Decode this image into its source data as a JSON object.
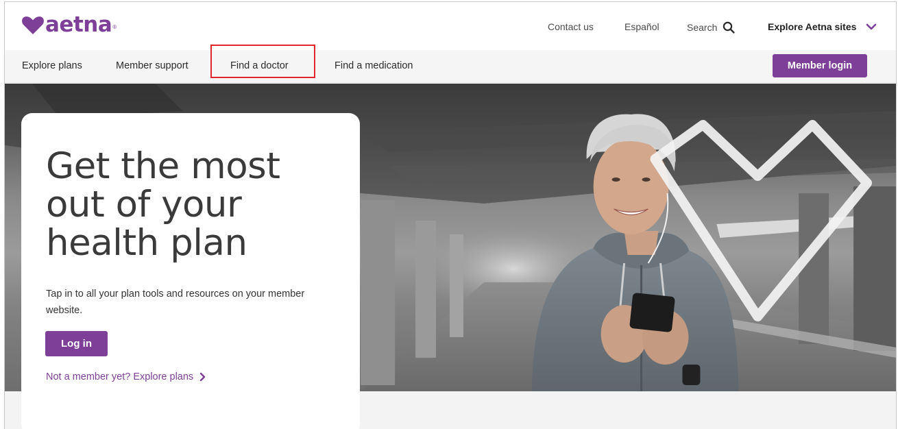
{
  "brand": {
    "name": "aetna",
    "registered_mark": "®",
    "color": "#7d3f98"
  },
  "utility_nav": {
    "contact": "Contact us",
    "espanol": "Español",
    "search": "Search",
    "explore_sites": "Explore Aetna sites"
  },
  "main_nav": {
    "items": [
      {
        "label": "Explore plans"
      },
      {
        "label": "Member support"
      },
      {
        "label": "Find a doctor"
      },
      {
        "label": "Find a medication"
      }
    ],
    "member_login": "Member login"
  },
  "hero": {
    "headline": "Get the most out of your health plan",
    "description": "Tap in to all your plan tools and resources on your member website.",
    "login_button": "Log in",
    "explore_link": "Not a member yet? Explore plans"
  },
  "icons": {
    "search": "search-icon",
    "explore_toggle": "chevron-down-icon",
    "link_arrow": "chevron-right-icon",
    "logo": "heart-logo-icon"
  },
  "colors": {
    "accent": "#7d3f98",
    "highlight": "#e0262b",
    "nav_bg": "#f5f5f5"
  }
}
